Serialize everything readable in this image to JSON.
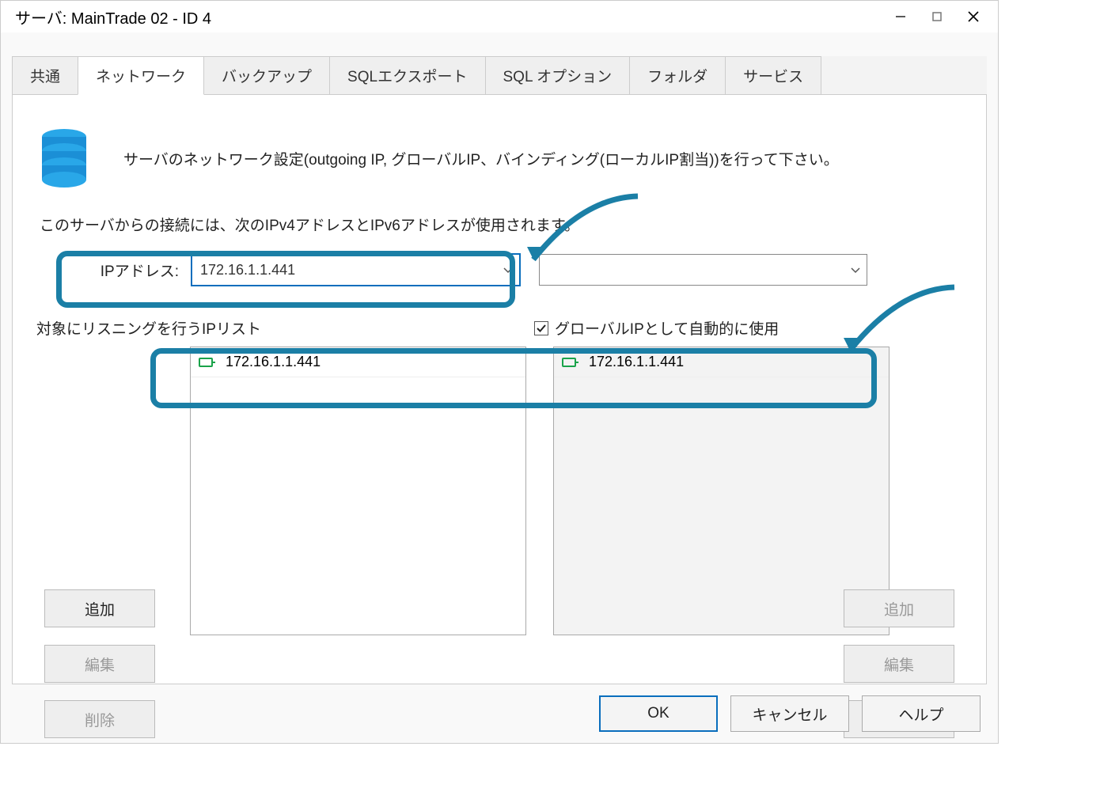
{
  "window": {
    "title": "サーバ: MainTrade 02 - ID  4"
  },
  "tabs": {
    "t0": "共通",
    "t1": "ネットワーク",
    "t2": "バックアップ",
    "t3": "SQLエクスポート",
    "t4": "SQL オプション",
    "t5": "フォルダ",
    "t6": "サービス"
  },
  "intro": "サーバのネットワーク設定(outgoing IP, グローバルIP、バインディング(ローカルIP割当))を行って下さい。",
  "connect_label": "このサーバからの接続には、次のIPv4アドレスとIPv6アドレスが使用されます。",
  "ip_label": "IPアドレス:",
  "ip_value": "172.16.1.1.441",
  "combo2_value": "",
  "listening_label": "対象にリスニングを行うIPリスト",
  "global_checkbox_label": "グローバルIPとして自動的に使用",
  "list_left": {
    "item0": "172.16.1.1.441"
  },
  "list_right": {
    "item0": "172.16.1.1.441"
  },
  "buttons": {
    "add": "追加",
    "edit": "編集",
    "delete": "削除",
    "ok": "OK",
    "cancel": "キャンセル",
    "help": "ヘルプ"
  },
  "colors": {
    "highlight": "#1b7fa6",
    "primary": "#0a6ebd"
  }
}
